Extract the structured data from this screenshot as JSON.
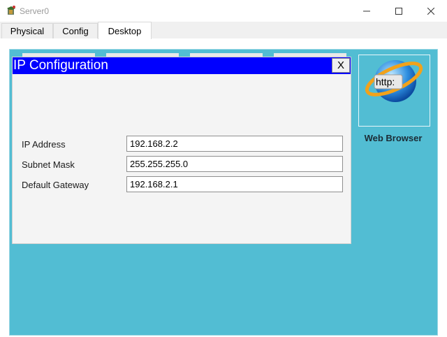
{
  "window": {
    "title": "Server0",
    "icon": "packet-tracer-server-icon"
  },
  "tabs": [
    {
      "label": "Physical"
    },
    {
      "label": "Config"
    },
    {
      "label": "Desktop",
      "active": true
    }
  ],
  "ip_config": {
    "title": "IP Configuration",
    "close_label": "X",
    "fields": [
      {
        "label": "IP Address",
        "value": "192.168.2.2"
      },
      {
        "label": "Subnet Mask",
        "value": "255.255.255.0"
      },
      {
        "label": "Default Gateway",
        "value": "192.168.2.1"
      }
    ]
  },
  "desktop_apps": [
    {
      "label": "Web Browser",
      "icon": "web-browser-icon",
      "icon_text": "http:"
    }
  ],
  "colors": {
    "desktop_bg": "#52bdd3",
    "dialog_title_bg": "#0000ff"
  }
}
